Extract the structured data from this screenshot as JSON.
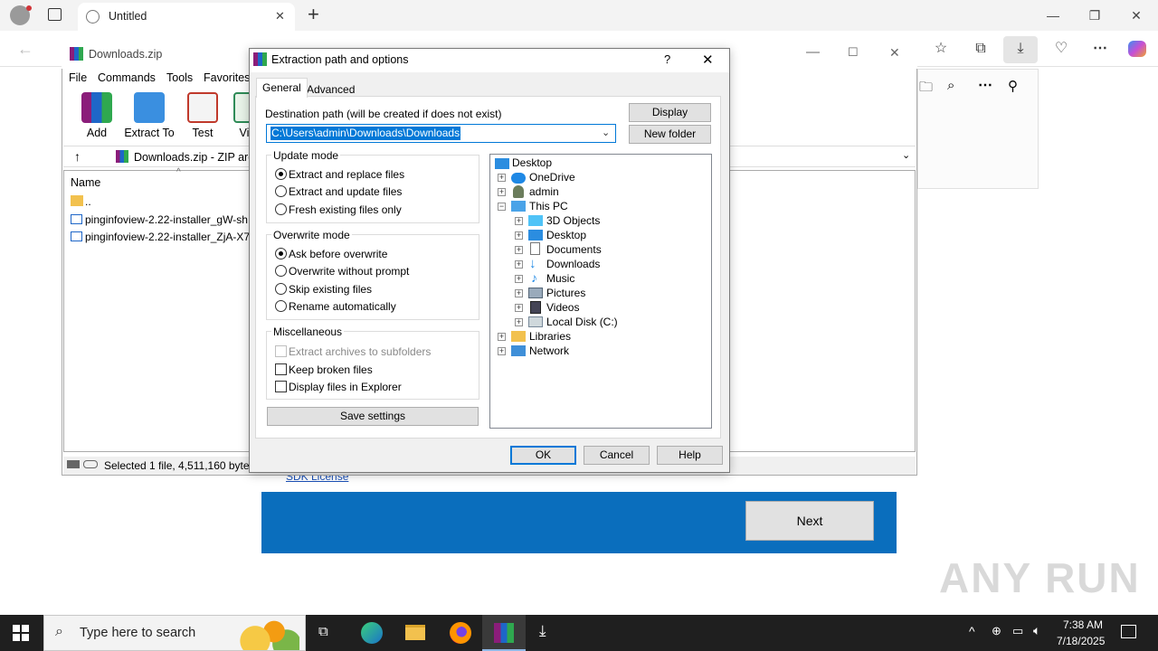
{
  "browser": {
    "tab_title": "Untitled",
    "new_tab": "+",
    "win_minimize": "—",
    "win_restore": "❐",
    "win_close": "✕"
  },
  "page": {
    "sdk_link": "SDK License",
    "next_button": "Next"
  },
  "winrar": {
    "title": "Downloads.zip",
    "menu": [
      "File",
      "Commands",
      "Tools",
      "Favorites"
    ],
    "tools": [
      "Add",
      "Extract To",
      "Test",
      "Vi"
    ],
    "address": "Downloads.zip - ZIP arch",
    "column_name": "Name",
    "files": [
      "..",
      "pinginfoview-2.22-installer_gW-sh",
      "pinginfoview-2.22-installer_ZjA-X7"
    ],
    "status": "Selected 1 file, 4,511,160 bytes"
  },
  "dialog": {
    "title": "Extraction path and options",
    "help_glyph": "?",
    "close_glyph": "✕",
    "tabs": [
      "General",
      "Advanced"
    ],
    "dest_label": "Destination path (will be created if does not exist)",
    "dest_value": "C:\\Users\\admin\\Downloads\\Downloads",
    "display_button": "Display",
    "new_folder_button": "New folder",
    "update_mode": {
      "title": "Update mode",
      "options": [
        "Extract and replace files",
        "Extract and update files",
        "Fresh existing files only"
      ],
      "selected": 0
    },
    "overwrite_mode": {
      "title": "Overwrite mode",
      "options": [
        "Ask before overwrite",
        "Overwrite without prompt",
        "Skip existing files",
        "Rename automatically"
      ],
      "selected": 0
    },
    "misc": {
      "title": "Miscellaneous",
      "options": [
        "Extract archives to subfolders",
        "Keep broken files",
        "Display files in Explorer"
      ]
    },
    "save_settings": "Save settings",
    "tree": [
      "Desktop",
      "OneDrive",
      "admin",
      "This PC",
      "3D Objects",
      "Desktop",
      "Documents",
      "Downloads",
      "Music",
      "Pictures",
      "Videos",
      "Local Disk (C:)",
      "Libraries",
      "Network"
    ],
    "ok": "OK",
    "cancel": "Cancel",
    "help": "Help"
  },
  "taskbar": {
    "search_placeholder": "Type here to search",
    "time": "7:38 AM",
    "date": "7/18/2025"
  },
  "watermark": "ANY RUN"
}
